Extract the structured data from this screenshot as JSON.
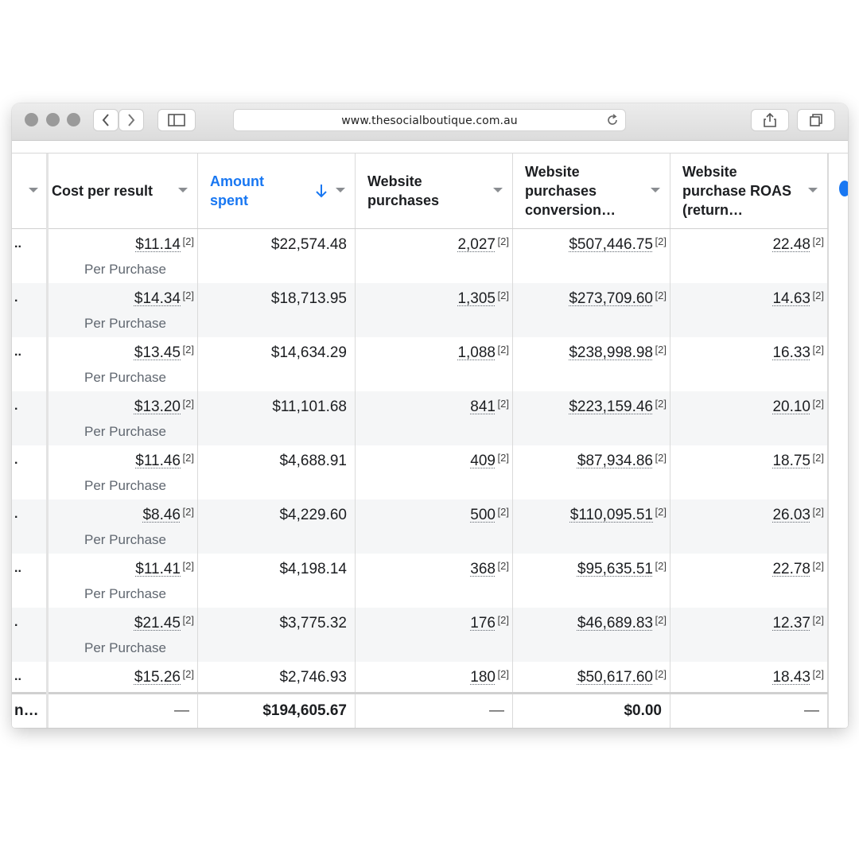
{
  "browser": {
    "url": "www.thesocialboutique.com.au",
    "icons": [
      "back-chevron-icon",
      "forward-chevron-icon",
      "sidebar-icon",
      "reload-icon",
      "share-icon",
      "tabs-icon"
    ]
  },
  "table": {
    "columns": [
      {
        "label": "Cost per result"
      },
      {
        "label": "Amount spent",
        "sorted": true
      },
      {
        "label": "Website purchases"
      },
      {
        "label": "Website purchases conversion…"
      },
      {
        "label": "Website purchase ROAS (return…"
      }
    ],
    "ref_marker": "[2]",
    "result_sub_label": "Per Purchase",
    "rows": [
      {
        "left": "..",
        "cost": "$11.14",
        "amount": "$22,574.48",
        "purchases": "2,027",
        "value": "$507,446.75",
        "roas": "22.48",
        "per": "Per Purchase"
      },
      {
        "left": ".",
        "cost": "$14.34",
        "amount": "$18,713.95",
        "purchases": "1,305",
        "value": "$273,709.60",
        "roas": "14.63",
        "per": "Per Purchase"
      },
      {
        "left": "..",
        "cost": "$13.45",
        "amount": "$14,634.29",
        "purchases": "1,088",
        "value": "$238,998.98",
        "roas": "16.33",
        "per": "Per Purchase"
      },
      {
        "left": ".",
        "cost": "$13.20",
        "amount": "$11,101.68",
        "purchases": "841",
        "value": "$223,159.46",
        "roas": "20.10",
        "per": "Per Purchase"
      },
      {
        "left": ".",
        "cost": "$11.46",
        "amount": "$4,688.91",
        "purchases": "409",
        "value": "$87,934.86",
        "roas": "18.75",
        "per": "Per Purchase"
      },
      {
        "left": ".",
        "cost": "$8.46",
        "amount": "$4,229.60",
        "purchases": "500",
        "value": "$110,095.51",
        "roas": "26.03",
        "per": "Per Purchase"
      },
      {
        "left": "..",
        "cost": "$11.41",
        "amount": "$4,198.14",
        "purchases": "368",
        "value": "$95,635.51",
        "roas": "22.78",
        "per": "Per Purchase"
      },
      {
        "left": ".",
        "cost": "$21.45",
        "amount": "$3,775.32",
        "purchases": "176",
        "value": "$46,689.83",
        "roas": "12.37",
        "per": "Per Purchase"
      },
      {
        "left": "..",
        "cost": "$15.26",
        "amount": "$2,746.93",
        "purchases": "180",
        "value": "$50,617.60",
        "roas": "18.43",
        "per": ""
      }
    ],
    "totals": {
      "left": "n…",
      "cost": "—",
      "amount": "$194,605.67",
      "purchases": "—",
      "value": "$0.00",
      "roas": "—"
    }
  }
}
